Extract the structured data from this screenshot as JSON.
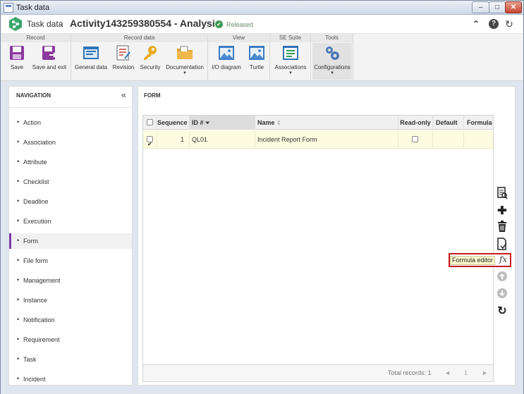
{
  "window": {
    "title": "Task data",
    "minimize": "–",
    "maximize": "□",
    "close": "✕"
  },
  "header": {
    "breadcrumb_root": "Task data",
    "breadcrumb_sep": "›",
    "title": "Activity143259380554 - Analysis",
    "status": "Released",
    "status_mark": "✔",
    "collapse_icon": "⌃",
    "help_icon": "?",
    "refresh_icon": "↻"
  },
  "ribbon": {
    "groups": [
      {
        "title": "Record"
      },
      {
        "title": "Record data"
      },
      {
        "title": "View"
      },
      {
        "title": "SE Suite"
      },
      {
        "title": "Tools"
      }
    ],
    "buttons": {
      "save": "Save",
      "save_exit": "Save and exit",
      "general_data": "General data",
      "revision": "Revision",
      "security": "Security",
      "documentation": "Documentation",
      "io_diagram": "I/O diagram",
      "turtle": "Turtle",
      "associations": "Associations",
      "configurations": "Configurations",
      "dropdown": "▼"
    }
  },
  "navigation": {
    "title": "NAVIGATION",
    "collapse_icon": "«",
    "bullet": "•",
    "items": [
      {
        "label": "Action"
      },
      {
        "label": "Association"
      },
      {
        "label": "Attribute"
      },
      {
        "label": "Checklist"
      },
      {
        "label": "Deadline"
      },
      {
        "label": "Execution"
      },
      {
        "label": "Form"
      },
      {
        "label": "File form"
      },
      {
        "label": "Management"
      },
      {
        "label": "Instance"
      },
      {
        "label": "Notification"
      },
      {
        "label": "Requirement"
      },
      {
        "label": "Task"
      },
      {
        "label": "Incident"
      }
    ],
    "selected": "Form"
  },
  "form": {
    "title": "FORM",
    "columns": {
      "sequence": "Sequence",
      "id": "ID #",
      "id_sort": "⏷",
      "name": "Name",
      "name_sort": "⇕",
      "readonly": "Read-only",
      "default": "Default",
      "formula": "Formula"
    },
    "rows": [
      {
        "sequence": "1",
        "id": "QL01",
        "name": "Incident Report Form",
        "checked": true,
        "readonly": false
      }
    ],
    "footer": {
      "total": "Total records: 1",
      "prev": "◄",
      "page": "1",
      "next": "►"
    }
  },
  "toolbar": {
    "add_icon": "✚",
    "delete_icon": "🗑",
    "up_icon": "⬆",
    "down_icon": "⬇",
    "refresh_icon": "↻",
    "formula_icon": "fx",
    "tooltip": "Formula editor"
  }
}
